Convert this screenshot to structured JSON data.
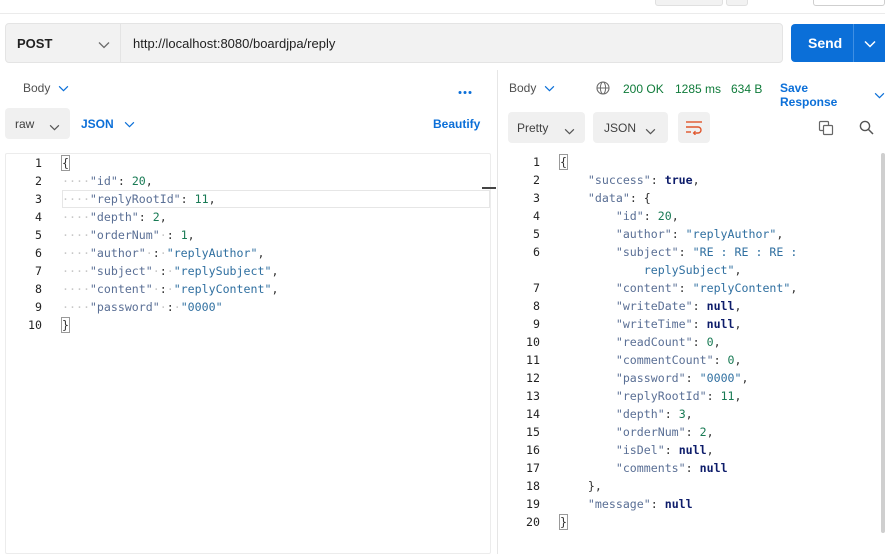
{
  "request": {
    "method": "POST",
    "url": "http://localhost:8080/boardjpa/reply",
    "send_label": "Send"
  },
  "left_pane": {
    "tab_label": "Body",
    "body_mode": "raw",
    "format": "JSON",
    "beautify_label": "Beautify",
    "lines": [
      {
        "n": "1"
      },
      {
        "n": "2"
      },
      {
        "n": "3"
      },
      {
        "n": "4"
      },
      {
        "n": "5"
      },
      {
        "n": "6"
      },
      {
        "n": "7"
      },
      {
        "n": "8"
      },
      {
        "n": "9"
      },
      {
        "n": "10"
      }
    ],
    "fields": {
      "id": {
        "key": "\"id\"",
        "value": "20"
      },
      "replyRootId": {
        "key": "\"replyRootId\"",
        "value": "11"
      },
      "depth": {
        "key": "\"depth\"",
        "value": "2"
      },
      "orderNum": {
        "key": "\"orderNum\"",
        "value": "1"
      },
      "author": {
        "key": "\"author\"",
        "value": "\"replyAuthor\""
      },
      "subject": {
        "key": "\"subject\"",
        "value": "\"replySubject\""
      },
      "content": {
        "key": "\"content\"",
        "value": "\"replyContent\""
      },
      "password": {
        "key": "\"password\"",
        "value": "\"0000\""
      }
    }
  },
  "right_pane": {
    "tab_label": "Body",
    "status": "200 OK",
    "time": "1285 ms",
    "size": "634 B",
    "save_label": "Save Response",
    "view_mode": "Pretty",
    "format": "JSON",
    "lines": [
      {
        "n": "1"
      },
      {
        "n": "2"
      },
      {
        "n": "3"
      },
      {
        "n": "4"
      },
      {
        "n": "5"
      },
      {
        "n": "6"
      },
      {
        "n": "7"
      },
      {
        "n": "8"
      },
      {
        "n": "9"
      },
      {
        "n": "10"
      },
      {
        "n": "11"
      },
      {
        "n": "12"
      },
      {
        "n": "13"
      },
      {
        "n": "14"
      },
      {
        "n": "15"
      },
      {
        "n": "16"
      },
      {
        "n": "17"
      },
      {
        "n": "18"
      },
      {
        "n": "19"
      },
      {
        "n": "20"
      }
    ],
    "fields": {
      "success": {
        "key": "\"success\"",
        "value": "true"
      },
      "data": {
        "key": "\"data\""
      },
      "id": {
        "key": "\"id\"",
        "value": "20"
      },
      "author": {
        "key": "\"author\"",
        "value": "\"replyAuthor\""
      },
      "subject": {
        "key": "\"subject\"",
        "value_part1": "\"RE : RE : RE :",
        "value_part2": "replySubject\""
      },
      "content": {
        "key": "\"content\"",
        "value": "\"replyContent\""
      },
      "writeDate": {
        "key": "\"writeDate\"",
        "value": "null"
      },
      "writeTime": {
        "key": "\"writeTime\"",
        "value": "null"
      },
      "readCount": {
        "key": "\"readCount\"",
        "value": "0"
      },
      "commentCount": {
        "key": "\"commentCount\"",
        "value": "0"
      },
      "password": {
        "key": "\"password\"",
        "value": "\"0000\""
      },
      "replyRootId": {
        "key": "\"replyRootId\"",
        "value": "11"
      },
      "depth": {
        "key": "\"depth\"",
        "value": "3"
      },
      "orderNum": {
        "key": "\"orderNum\"",
        "value": "2"
      },
      "isDel": {
        "key": "\"isDel\"",
        "value": "null"
      },
      "comments": {
        "key": "\"comments\"",
        "value": "null"
      },
      "message": {
        "key": "\"message\"",
        "value": "null"
      }
    }
  },
  "colors": {
    "accent": "#0b6fd8",
    "status_ok": "#0f7b3a",
    "json_key": "#5a6f95",
    "json_string": "#2f6fa0",
    "json_number": "#187a54",
    "json_keyword": "#0d1c6a"
  },
  "icons": [
    "chevron-down-icon",
    "more-icon",
    "globe-icon",
    "wrap-lines-icon",
    "copy-icon",
    "search-icon"
  ]
}
